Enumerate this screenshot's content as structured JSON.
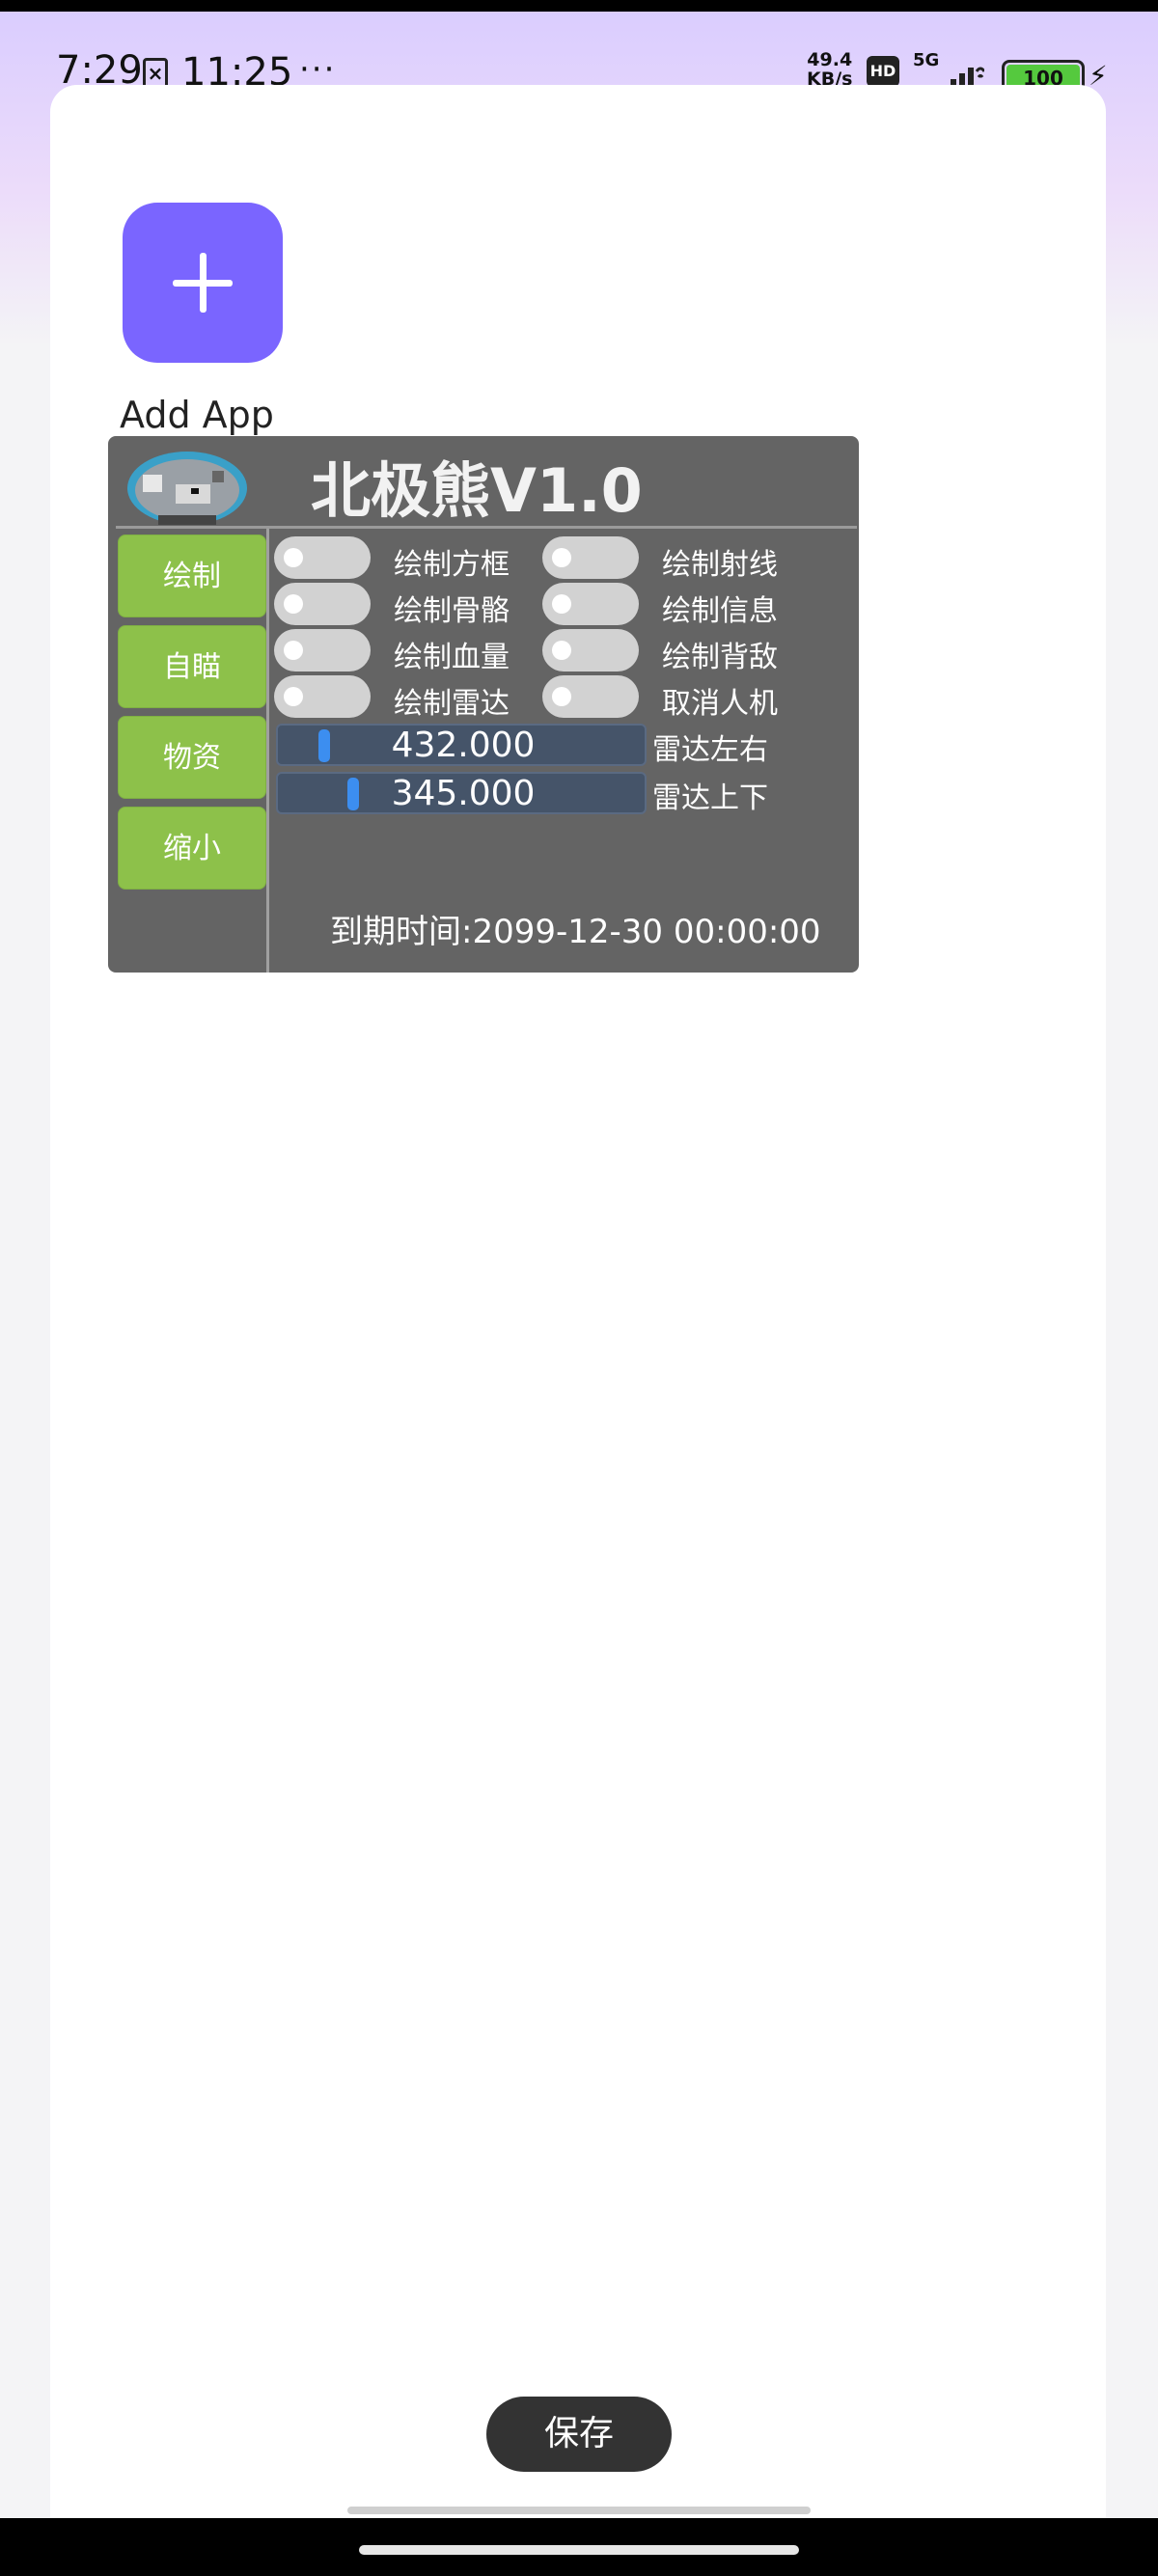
{
  "status_bar": {
    "time": "7:29",
    "notif_icon": "x-box-icon",
    "clock": "11:25",
    "more": "···",
    "net_speed_value": "49.4",
    "net_speed_unit": "KB/s",
    "hd": "HD",
    "network": "5G",
    "battery": "100"
  },
  "launcher": {
    "add_app_label": "Add App"
  },
  "menu": {
    "title": "北极熊V1.0",
    "nav": [
      "绘制",
      "自瞄",
      "物资",
      "缩小"
    ],
    "options": [
      "绘制方框",
      "绘制射线",
      "绘制骨骼",
      "绘制信息",
      "绘制血量",
      "绘制背敌",
      "绘制雷达",
      "取消人机"
    ],
    "sliders": [
      {
        "value": "432.000",
        "label": "雷达左右",
        "fraction": 0.11
      },
      {
        "value": "345.000",
        "label": "雷达上下",
        "fraction": 0.19
      }
    ],
    "expire": "到期时间:2099-12-30 00:00:00"
  },
  "footer": {
    "save_label": "保存"
  },
  "colors": {
    "accent": "#7a65ff",
    "nav_green": "#8dc14a",
    "panel_bg": "#646464",
    "slider_thumb": "#3c8ef0"
  }
}
